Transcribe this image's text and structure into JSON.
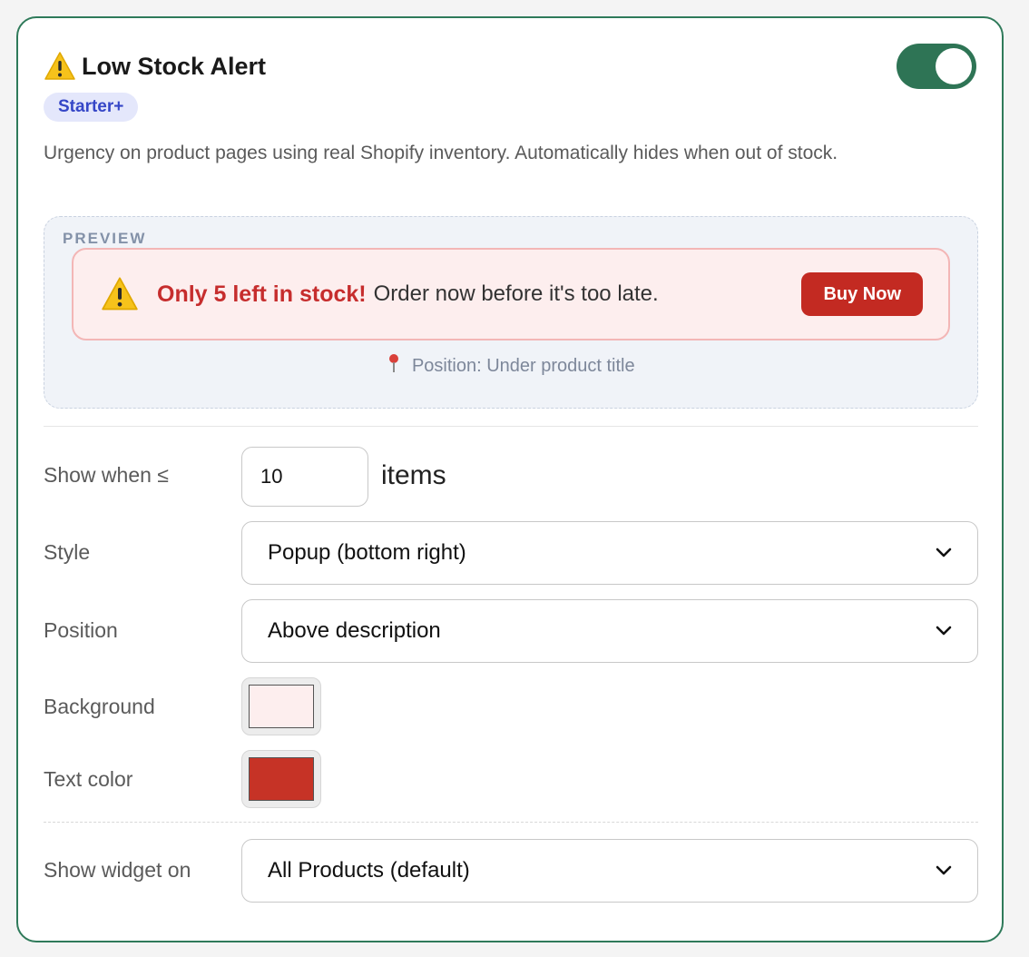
{
  "widget": {
    "title": "Low Stock Alert",
    "badge": "Starter+",
    "description": "Urgency on product pages using real Shopify inventory. Automatically hides when out of stock.",
    "enabled": true
  },
  "preview": {
    "label": "PREVIEW",
    "alert_bold": "Only 5 left in stock!",
    "alert_text": "Order now before it's too late.",
    "button_label": "Buy Now",
    "position_note": "Position: Under product title"
  },
  "settings": {
    "threshold_label": "Show when ≤",
    "threshold_value": "10",
    "threshold_unit": "items",
    "style_label": "Style",
    "style_value": "Popup (bottom right)",
    "position_label": "Position",
    "position_value": "Above description",
    "background_label": "Background",
    "text_color_label": "Text color",
    "show_on_label": "Show widget on",
    "show_on_value": "All Products (default)"
  },
  "colors": {
    "accent": "#2e7455",
    "background_swatch": "#fdeeee",
    "text_color_swatch": "#c63326",
    "alert_text": "#c62d2d",
    "button": "#c32a22"
  },
  "icons": {
    "title_icon": "warning-icon",
    "alert_icon": "warning-icon",
    "position_icon": "pin-icon",
    "select_icon": "chevron-down-icon"
  }
}
